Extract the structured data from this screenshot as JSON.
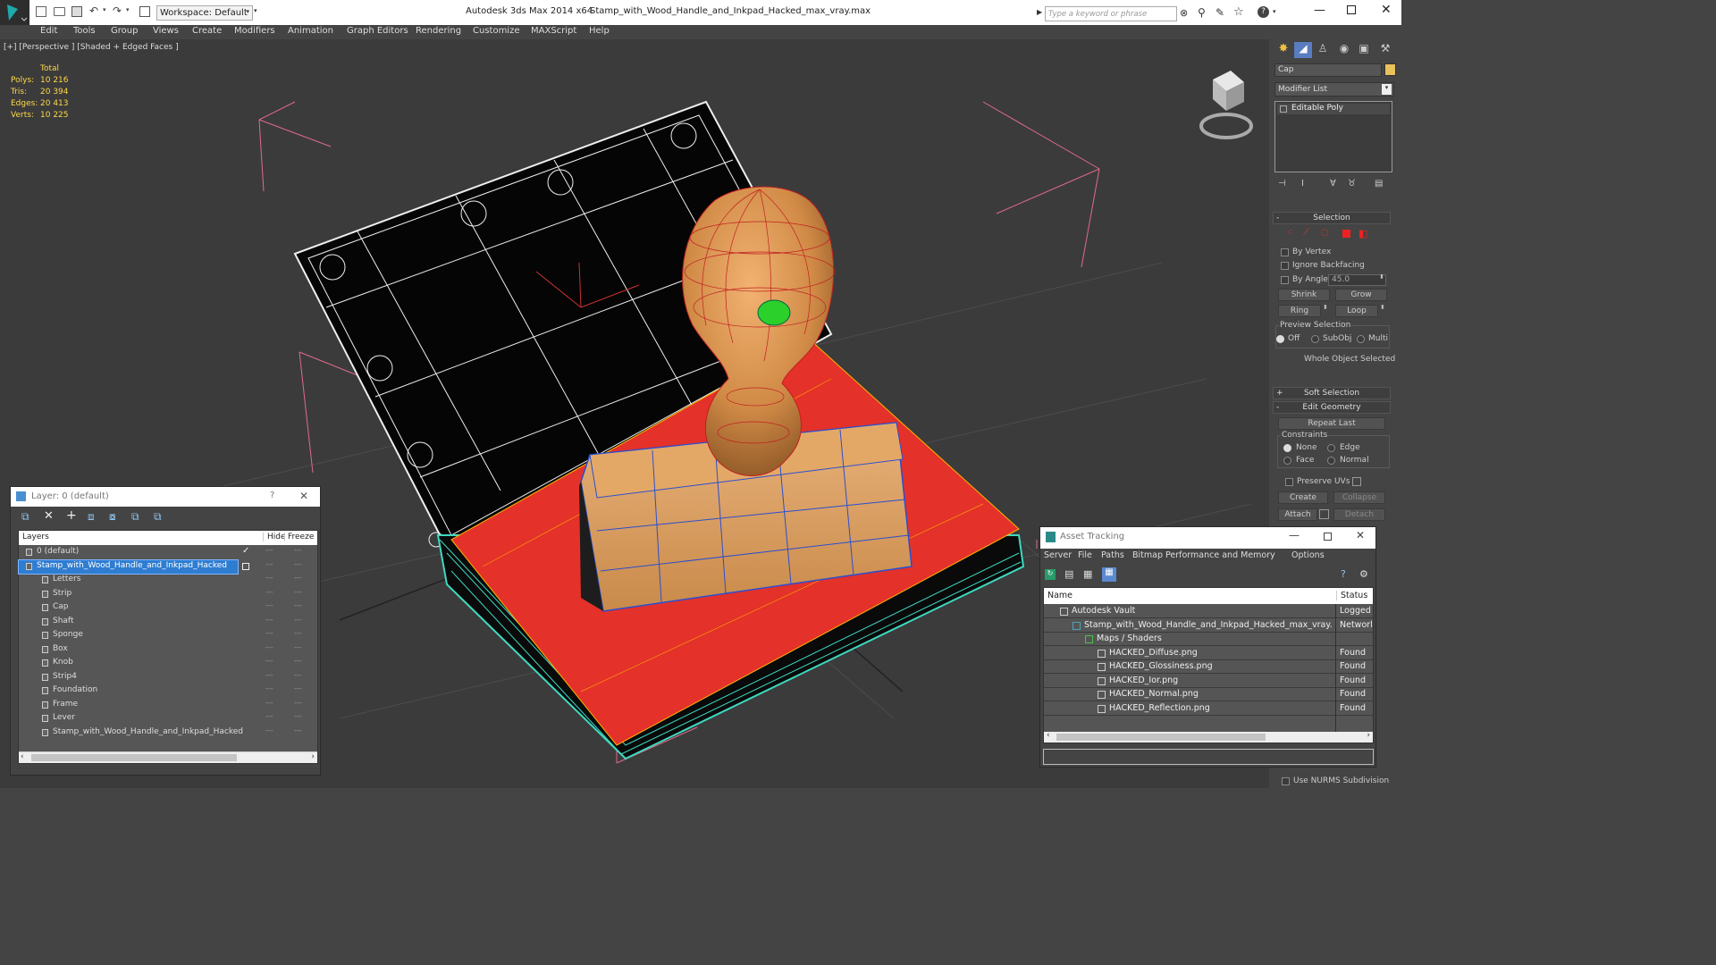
{
  "titlebar": {
    "app_title": "Autodesk 3ds Max  2014 x64",
    "file_title": "Stamp_with_Wood_Handle_and_Inkpad_Hacked_max_vray.max",
    "workspace": "Workspace: Default",
    "search_placeholder": "Type a keyword or phrase"
  },
  "menu": [
    "Edit",
    "Tools",
    "Group",
    "Views",
    "Create",
    "Modifiers",
    "Animation",
    "Graph Editors",
    "Rendering",
    "Customize",
    "MAXScript",
    "Help"
  ],
  "viewport": {
    "label": "[+] [Perspective ] [Shaded + Edged Faces ]",
    "stats": {
      "header": "Total",
      "rows": [
        {
          "label": "Polys:",
          "value": "10 216"
        },
        {
          "label": "Tris:",
          "value": "20 394"
        },
        {
          "label": "Edges:",
          "value": "20 413"
        },
        {
          "label": "Verts:",
          "value": "10 225"
        }
      ]
    }
  },
  "command_panel": {
    "object_name": "Cap",
    "object_color": "#e8c25a",
    "modifier_list": "Modifier List",
    "stack_item": "Editable Poly",
    "selection": {
      "header": "Selection",
      "by_vertex": "By Vertex",
      "ignore_backfacing": "Ignore Backfacing",
      "by_angle": "By Angle:",
      "angle_value": "45.0",
      "shrink": "Shrink",
      "grow": "Grow",
      "ring": "Ring",
      "loop": "Loop",
      "preview_selection": "Preview Selection",
      "off": "Off",
      "subobj": "SubObj",
      "multi": "Multi",
      "status": "Whole Object Selected"
    },
    "soft_selection": "Soft Selection",
    "edit_geometry": {
      "header": "Edit Geometry",
      "repeat_last": "Repeat Last",
      "constraints": "Constraints",
      "none": "None",
      "edge": "Edge",
      "face": "Face",
      "normal": "Normal",
      "preserve_uvs": "Preserve UVs",
      "create": "Create",
      "collapse": "Collapse",
      "attach": "Attach",
      "detach": "Detach"
    },
    "bottom_option": "Use NURMS Subdivision"
  },
  "layer_window": {
    "title": "Layer: 0 (default)",
    "help": "?",
    "close": "✕",
    "col_layers": "Layers",
    "col_hide": "Hide",
    "col_freeze": "Freeze",
    "rows": [
      {
        "name": "0 (default)",
        "indent": 1,
        "selected": false,
        "active": true
      },
      {
        "name": "Stamp_with_Wood_Handle_and_Inkpad_Hacked",
        "indent": 1,
        "selected": true,
        "active": false
      },
      {
        "name": "Letters",
        "indent": 2,
        "selected": false,
        "active": false
      },
      {
        "name": "Strip",
        "indent": 2,
        "selected": false,
        "active": false
      },
      {
        "name": "Cap",
        "indent": 2,
        "selected": false,
        "active": false
      },
      {
        "name": "Shaft",
        "indent": 2,
        "selected": false,
        "active": false
      },
      {
        "name": "Sponge",
        "indent": 2,
        "selected": false,
        "active": false
      },
      {
        "name": "Box",
        "indent": 2,
        "selected": false,
        "active": false
      },
      {
        "name": "Knob",
        "indent": 2,
        "selected": false,
        "active": false
      },
      {
        "name": "Strip4",
        "indent": 2,
        "selected": false,
        "active": false
      },
      {
        "name": "Foundation",
        "indent": 2,
        "selected": false,
        "active": false
      },
      {
        "name": "Frame",
        "indent": 2,
        "selected": false,
        "active": false
      },
      {
        "name": "Lever",
        "indent": 2,
        "selected": false,
        "active": false
      },
      {
        "name": "Stamp_with_Wood_Handle_and_Inkpad_Hacked",
        "indent": 2,
        "selected": false,
        "active": false
      }
    ]
  },
  "asset_window": {
    "title": "Asset Tracking",
    "menu": [
      "Server",
      "File",
      "Paths",
      "Bitmap Performance and Memory",
      "Options"
    ],
    "col_name": "Name",
    "col_status": "Status",
    "rows": [
      {
        "name": "Autodesk Vault",
        "status": "Logged O",
        "indent": 1
      },
      {
        "name": "Stamp_with_Wood_Handle_and_Inkpad_Hacked_max_vray.max",
        "status": "Network",
        "indent": 2
      },
      {
        "name": "Maps / Shaders",
        "status": "",
        "indent": 3
      },
      {
        "name": "HACKED_Diffuse.png",
        "status": "Found",
        "indent": 4
      },
      {
        "name": "HACKED_Glossiness.png",
        "status": "Found",
        "indent": 4
      },
      {
        "name": "HACKED_Ior.png",
        "status": "Found",
        "indent": 4
      },
      {
        "name": "HACKED_Normal.png",
        "status": "Found",
        "indent": 4
      },
      {
        "name": "HACKED_Reflection.png",
        "status": "Found",
        "indent": 4
      }
    ]
  }
}
